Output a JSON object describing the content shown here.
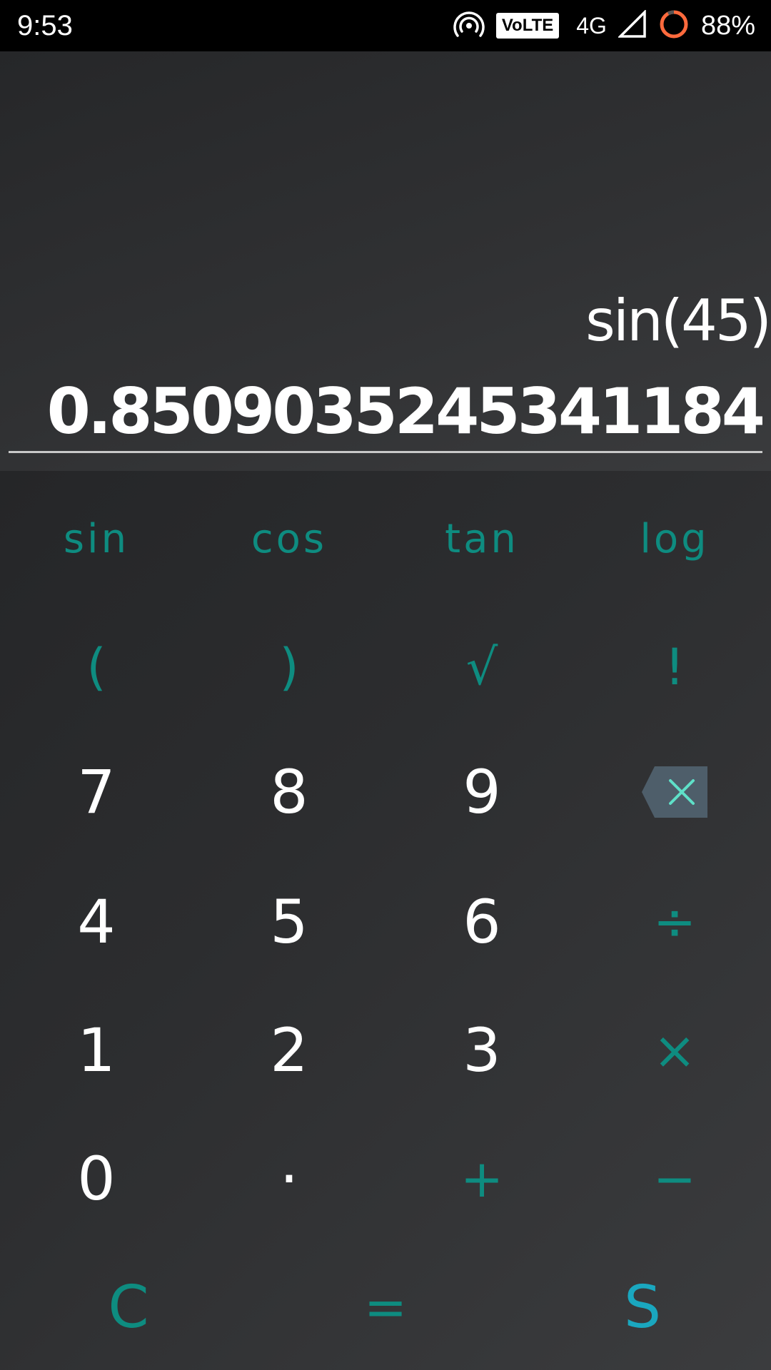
{
  "status_bar": {
    "time": "9:53",
    "volte": "VoLTE",
    "network_type": "4G",
    "battery_percent": "88%",
    "icons": [
      "hotspot-icon",
      "volte-icon",
      "signal-icon",
      "battery-ring-icon"
    ]
  },
  "display": {
    "expression": "sin(45)",
    "result": "0.8509035245341184"
  },
  "keypad": {
    "function_row": [
      "sin",
      "cos",
      "tan",
      "log"
    ],
    "symbol_row": [
      "(",
      ")",
      "√",
      "!"
    ],
    "row_789": [
      "7",
      "8",
      "9"
    ],
    "backspace_icon": "backspace-icon",
    "row_456": [
      "4",
      "5",
      "6",
      "÷"
    ],
    "row_123": [
      "1",
      "2",
      "3",
      "×"
    ],
    "row_0": [
      "0",
      "·",
      "+",
      "−"
    ],
    "bottom_row": [
      "C",
      "=",
      "S"
    ]
  },
  "colors": {
    "accent_teal": "#0e8c80",
    "accent_cyan": "#1aa7bf",
    "display_bg": "#303133",
    "keypad_bg": "#2c2d2f",
    "backspace_bg": "#4e5e6a"
  }
}
